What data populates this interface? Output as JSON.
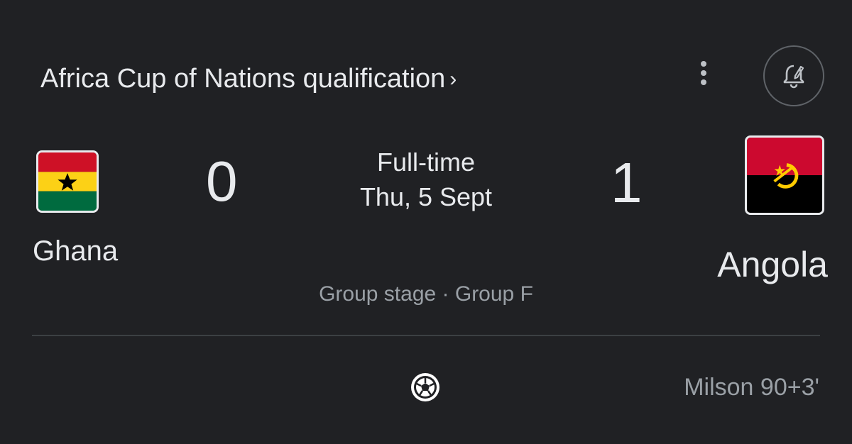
{
  "competition": {
    "title": "Africa Cup of Nations qualification",
    "chevron": "›"
  },
  "actions": {
    "menu_icon": "more-vert-icon",
    "alert_icon": "notification-bell-icon"
  },
  "match": {
    "status": "Full-time",
    "date": "Thu, 5 Sept",
    "stage": "Group stage · Group F"
  },
  "home": {
    "name": "Ghana",
    "score": "0",
    "flag_colors": [
      "#ce1126",
      "#fcd116",
      "#006b3f"
    ]
  },
  "away": {
    "name": "Angola",
    "score": "1",
    "flag_colors": [
      "#cc092f",
      "#000000",
      "#ffcb00"
    ]
  },
  "events": [
    {
      "icon": "soccer-ball-icon",
      "scorer": "Milson 90+3'",
      "team": "away"
    }
  ]
}
